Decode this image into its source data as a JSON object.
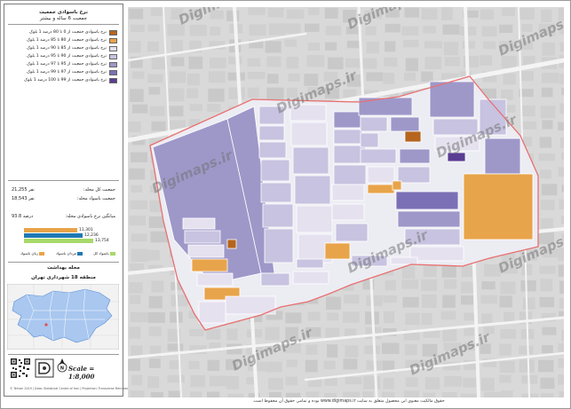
{
  "panel": {
    "title": "نرخ باسوادی جمعیت",
    "subtitle": "جمعیت 6 ساله و بیشتر",
    "legend": [
      {
        "label": "نرخ باسوادی جمعیت از 0 تا 80 درصد 1 بلوک",
        "color": "#b5651d"
      },
      {
        "label": "نرخ باسوادی جمعیت از 80 تا 85 درصد 1 بلوک",
        "color": "#e8a44a"
      },
      {
        "label": "نرخ باسوادی جمعیت از 85 تا 90 درصد 1 بلوک",
        "color": "#e6e1ef"
      },
      {
        "label": "نرخ باسوادی جمعیت از 90 تا 95 درصد 1 بلوک",
        "color": "#c7c3e0"
      },
      {
        "label": "نرخ باسوادی جمعیت از 95 تا 97 درصد 1 بلوک",
        "color": "#9e98c9"
      },
      {
        "label": "نرخ باسوادی جمعیت از 97 تا 99 درصد 1 بلوک",
        "color": "#7b70b5"
      },
      {
        "label": "نرخ باسوادی جمعیت از 99 تا 100 درصد 1 بلوک",
        "color": "#5b3d93"
      }
    ],
    "stats": [
      {
        "label": "جمعیت کل محله:",
        "value": "21,255 نفر"
      },
      {
        "label": "جمعیت باسواد محله:",
        "value": "18,543 نفر"
      },
      {
        "label": "میانگین نرخ باسوادی محله:",
        "value": "93.8 درصد"
      }
    ],
    "bars": [
      {
        "label": "11,301",
        "fraction": 0.6,
        "color": "#e8a44a"
      },
      {
        "label": "12,236",
        "fraction": 0.66,
        "color": "#1f78b4"
      },
      {
        "label": "13,754",
        "fraction": 0.78,
        "color": "#a6d96a"
      }
    ],
    "bar_categories": [
      {
        "label": "زنان باسواد",
        "color": "#e8a44a"
      },
      {
        "label": "مردان باسواد",
        "color": "#1f78b4"
      },
      {
        "label": "باسواد کل",
        "color": "#a6d96a"
      }
    ],
    "district_title": "محله بهداشت",
    "district_subtitle": "منطقه 18 شهرداری تهران",
    "scale": "Scale = 1:8,000",
    "copyright": "© Tehran 2019 | Data: Statistical Centre of Iran | Projection: Transverse Mercator"
  },
  "map": {
    "watermark": "Digimaps.ir",
    "highlight_color": "#e87070"
  },
  "footer": "حقوق مالکیت معنوی این محصول متعلق به سایت www.digimaps.ir بوده و تمامی حقوق آن محفوظ است."
}
